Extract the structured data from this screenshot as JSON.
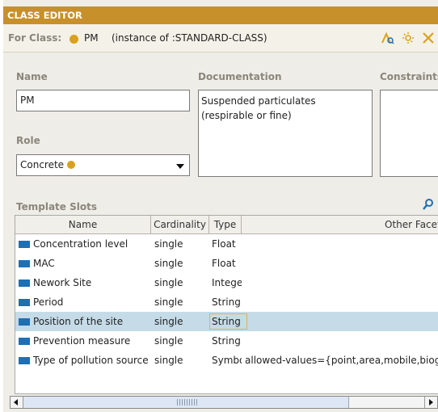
{
  "window": {
    "title": "CLASS EDITOR"
  },
  "for_class": {
    "label": "For Class:",
    "class_name": "PM",
    "instance_of": "(instance of :STANDARD-CLASS)",
    "icons": [
      "find-icon",
      "settings-icon",
      "close-icon"
    ],
    "class_color": "#d9a21a"
  },
  "fields": {
    "name_label": "Name",
    "name_value": "PM",
    "documentation_label": "Documentation",
    "documentation_value": "Suspended particulates (respirable or fine)",
    "constraints_label": "Constraints",
    "role_label": "Role",
    "role_value": "Concrete"
  },
  "template_slots": {
    "label": "Template Slots",
    "columns": [
      "Name",
      "Cardinality",
      "Type",
      "Other Facets"
    ],
    "rows": [
      {
        "name": "Concentration level",
        "cardinality": "single",
        "type": "Float",
        "facets": ""
      },
      {
        "name": "MAC",
        "cardinality": "single",
        "type": "Float",
        "facets": ""
      },
      {
        "name": "Nework Site",
        "cardinality": "single",
        "type": "Integer",
        "facets": ""
      },
      {
        "name": "Period",
        "cardinality": "single",
        "type": "String",
        "facets": ""
      },
      {
        "name": "Position of the site",
        "cardinality": "single",
        "type": "String",
        "facets": "",
        "selected": true
      },
      {
        "name": "Prevention measure",
        "cardinality": "single",
        "type": "String",
        "facets": ""
      },
      {
        "name": "Type of pollution source",
        "cardinality": "single",
        "type": "Symbol",
        "facets": "allowed-values={point,area,mobile,biogenic"
      }
    ]
  },
  "colors": {
    "titlebar": "#c8902a",
    "selection": "#c5dbe8",
    "slot_icon": "#1f6fb3",
    "class_dot": "#d9a21a"
  }
}
